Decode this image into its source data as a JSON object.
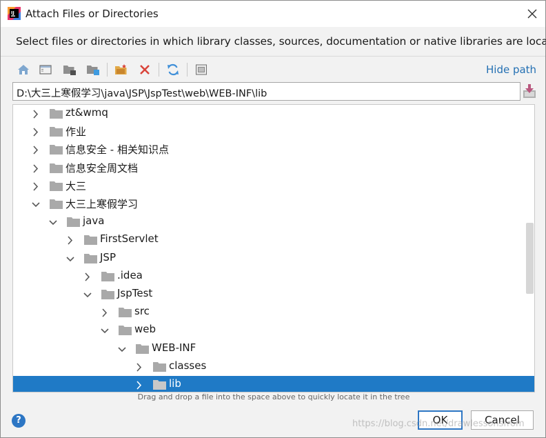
{
  "window": {
    "title": "Attach Files or Directories",
    "description": "Select files or directories in which library classes, sources, documentation or native libraries are located"
  },
  "toolbar": {
    "buttons": [
      {
        "name": "home-directory-button",
        "icon": "home-icon"
      },
      {
        "name": "desktop-directory-button",
        "icon": "desktop-icon"
      },
      {
        "name": "project-directory-button",
        "icon": "project-folder-icon"
      },
      {
        "name": "module-directory-button",
        "icon": "module-folder-icon"
      },
      {
        "name": "new-folder-button",
        "icon": "new-folder-icon"
      },
      {
        "name": "delete-button",
        "icon": "delete-icon"
      },
      {
        "name": "refresh-button",
        "icon": "refresh-icon"
      },
      {
        "name": "show-hidden-button",
        "icon": "show-hidden-icon"
      }
    ],
    "hide_path_label": "Hide path"
  },
  "path": {
    "value": "D:\\大三上寒假学习\\java\\JSP\\JspTest\\web\\WEB-INF\\lib"
  },
  "tree": {
    "rows": [
      {
        "label": "zt&wmq",
        "depth": 0,
        "expanded": false,
        "selected": false
      },
      {
        "label": "作业",
        "depth": 0,
        "expanded": false,
        "selected": false
      },
      {
        "label": "信息安全 - 相关知识点",
        "depth": 0,
        "expanded": false,
        "selected": false
      },
      {
        "label": "信息安全周文档",
        "depth": 0,
        "expanded": false,
        "selected": false
      },
      {
        "label": "大三",
        "depth": 0,
        "expanded": false,
        "selected": false
      },
      {
        "label": "大三上寒假学习",
        "depth": 0,
        "expanded": true,
        "selected": false
      },
      {
        "label": "java",
        "depth": 1,
        "expanded": true,
        "selected": false
      },
      {
        "label": "FirstServlet",
        "depth": 2,
        "expanded": false,
        "selected": false
      },
      {
        "label": "JSP",
        "depth": 2,
        "expanded": true,
        "selected": false
      },
      {
        "label": ".idea",
        "depth": 3,
        "expanded": false,
        "selected": false
      },
      {
        "label": "JspTest",
        "depth": 3,
        "expanded": true,
        "selected": false
      },
      {
        "label": "src",
        "depth": 4,
        "expanded": false,
        "selected": false
      },
      {
        "label": "web",
        "depth": 4,
        "expanded": true,
        "selected": false
      },
      {
        "label": "WEB-INF",
        "depth": 5,
        "expanded": true,
        "selected": false
      },
      {
        "label": "classes",
        "depth": 6,
        "expanded": false,
        "selected": false
      },
      {
        "label": "lib",
        "depth": 6,
        "expanded": false,
        "selected": true
      }
    ]
  },
  "hint": "Drag and drop a file into the space above to quickly locate it in the tree",
  "buttons": {
    "ok": "OK",
    "cancel": "Cancel",
    "help": "?"
  },
  "watermark": "https://blog.csdn.net/drawlessonsfrom",
  "colors": {
    "selection": "#1f7ac6",
    "link": "#2470b3",
    "folder": "#a9a9a9",
    "arrow": "#595959",
    "default_button_border": "#2d76c4",
    "delete_red": "#d9443a"
  }
}
